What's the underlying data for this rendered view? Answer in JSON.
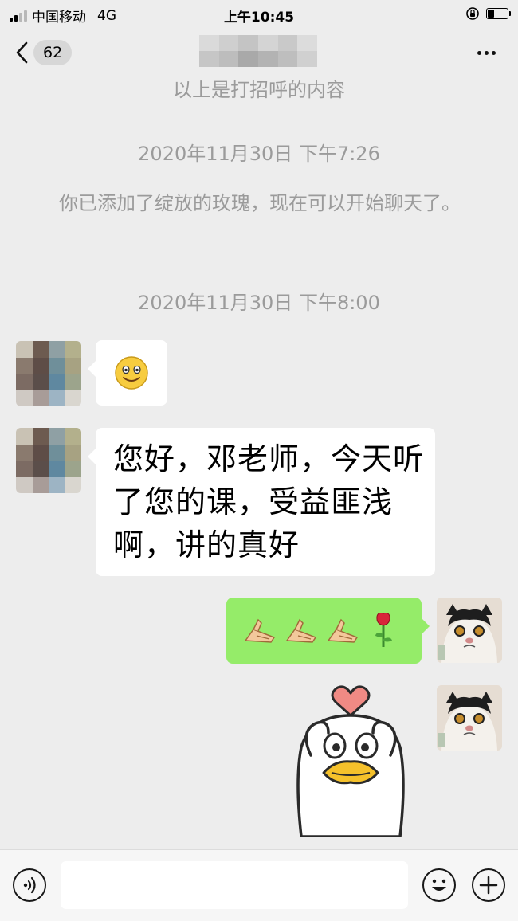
{
  "status_bar": {
    "carrier": "中国移动",
    "network": "4G",
    "time": "上午10:45",
    "battery_level": 0.35
  },
  "navbar": {
    "back_icon": "chevron-left-icon",
    "unread_count": "62",
    "more_icon": "more-dots-icon"
  },
  "messages": {
    "sys_greeting": "以上是打招呼的内容",
    "time_1": "2020年11月30日 下午7:26",
    "sys_added": "你已添加了绽放的玫瑰，现在可以开始聊天了。",
    "time_2": "2020年11月30日 下午8:00",
    "incoming_1_icon": "smile-emoji-icon",
    "incoming_2_text": "您好，邓老师，今天听了您的课，受益匪浅啊，讲的真好",
    "outgoing_1_icons": [
      "thumbs-up-emoji-icon",
      "thumbs-up-emoji-icon",
      "thumbs-up-emoji-icon",
      "rose-emoji-icon"
    ],
    "outgoing_2_icon": "cartoon-duck-heart-sticker-icon"
  },
  "input_bar": {
    "voice_icon": "voice-icon",
    "placeholder": "",
    "emoji_icon": "emoji-icon",
    "add_icon": "plus-icon"
  },
  "colors": {
    "background": "#ededed",
    "outgoing_bubble": "#95ec69",
    "incoming_bubble": "#ffffff",
    "system_text": "#9b9b9b"
  }
}
